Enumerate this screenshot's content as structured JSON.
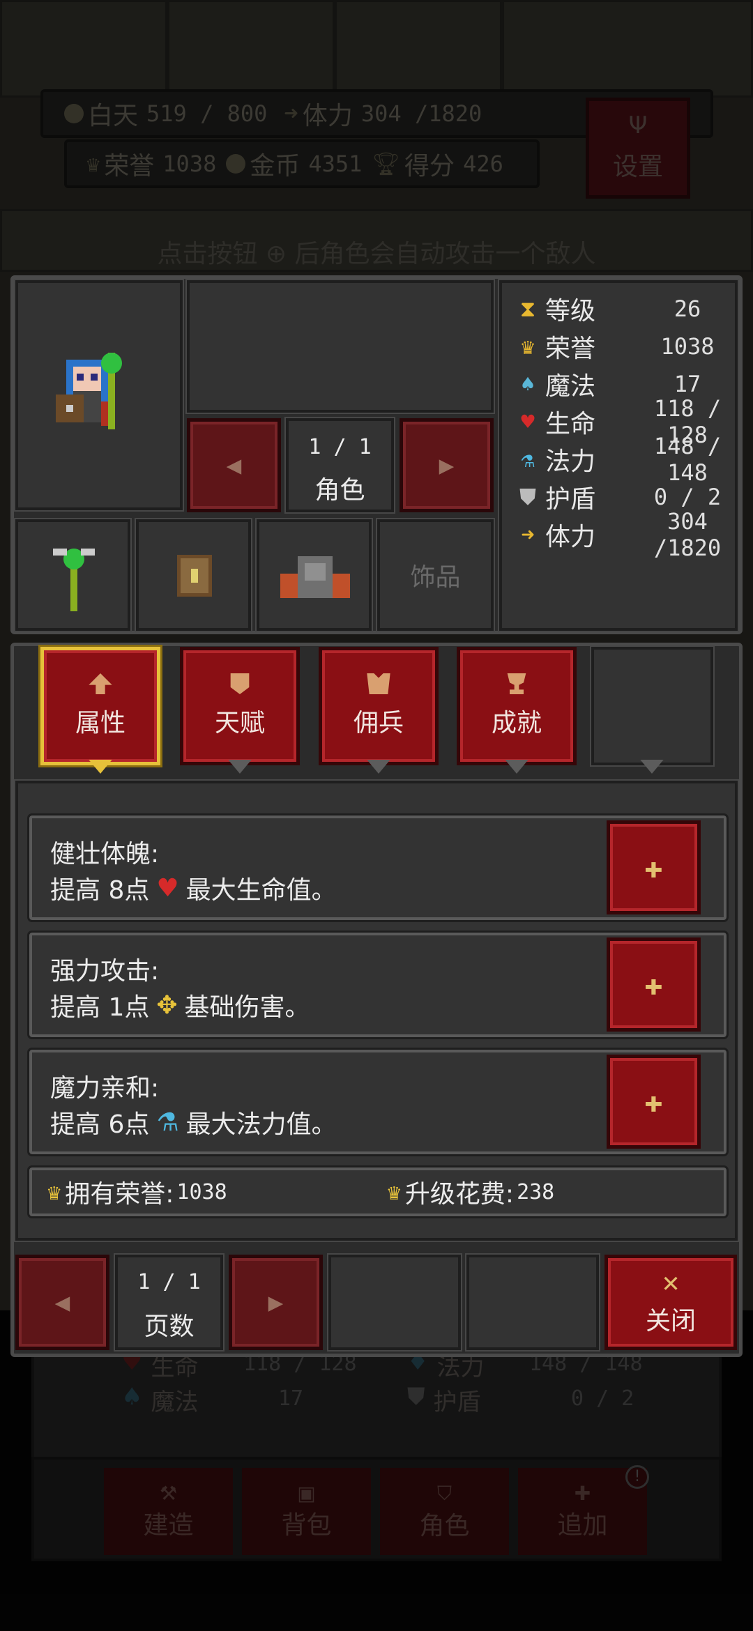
{
  "hud": {
    "day_label": "白天",
    "day_value": "519 / 800",
    "stamina_label": "体力",
    "stamina_value": "304 /1820",
    "honor_label": "荣誉",
    "honor_value": "1038",
    "gold_label": "金币",
    "gold_value": "4351",
    "score_label": "得分",
    "score_value": "426",
    "settings_label": "设置"
  },
  "hint": "点击按钮 ⊕ 后角色会自动攻击一个敌人",
  "character": {
    "page": "1 / 1",
    "page_label": "角色",
    "accessory_label": "饰品"
  },
  "stats": [
    {
      "name": "等级",
      "value": "26",
      "icon": "hourglass-icon",
      "color": "#e8b830"
    },
    {
      "name": "荣誉",
      "value": "1038",
      "icon": "crown-icon",
      "color": "#e8b830"
    },
    {
      "name": "魔法",
      "value": "17",
      "icon": "magic-icon",
      "color": "#5ab7d8"
    },
    {
      "name": "生命",
      "value": "118 / 128",
      "icon": "heart-icon",
      "color": "#d62a2a"
    },
    {
      "name": "法力",
      "value": "148 / 148",
      "icon": "potion-icon",
      "color": "#4fb8e0"
    },
    {
      "name": "护盾",
      "value": "0 / 2",
      "icon": "shield-icon",
      "color": "#bcbcbc"
    },
    {
      "name": "体力",
      "value": "304 /1820",
      "icon": "lightning-icon",
      "color": "#e8b830"
    }
  ],
  "tabs": [
    {
      "label": "属性",
      "icon": "arrow-up-icon"
    },
    {
      "label": "天赋",
      "icon": "badge-icon"
    },
    {
      "label": "佣兵",
      "icon": "armor-icon"
    },
    {
      "label": "成就",
      "icon": "trophy-icon"
    }
  ],
  "traits": [
    {
      "title": "健壮体魄:",
      "prefix": "提高 8点",
      "suffix": "最大生命值。",
      "icon": "heart-icon"
    },
    {
      "title": "强力攻击:",
      "prefix": "提高 1点",
      "suffix": "基础伤害。",
      "icon": "crosshair-icon"
    },
    {
      "title": "魔力亲和:",
      "prefix": "提高 6点",
      "suffix": "最大法力值。",
      "icon": "potion-icon"
    }
  ],
  "summary": {
    "owned_label": "拥有荣誉:",
    "owned_value": "1038",
    "cost_label": "升级花费:",
    "cost_value": "238"
  },
  "footer": {
    "page": "1 / 1",
    "page_label": "页数",
    "close_label": "关闭"
  },
  "background_hud": {
    "hp_label": "生命",
    "hp_value": "118 / 128",
    "mp_label": "法力",
    "mp_value": "148 / 148",
    "magic_label": "魔法",
    "magic_value": "17",
    "shield_label": "护盾",
    "shield_value": "0 / 2"
  },
  "bottom_nav": [
    {
      "label": "建造",
      "icon": "hammer-icon"
    },
    {
      "label": "背包",
      "icon": "bag-icon"
    },
    {
      "label": "角色",
      "icon": "badge-icon"
    },
    {
      "label": "追加",
      "icon": "plus-icon"
    }
  ]
}
